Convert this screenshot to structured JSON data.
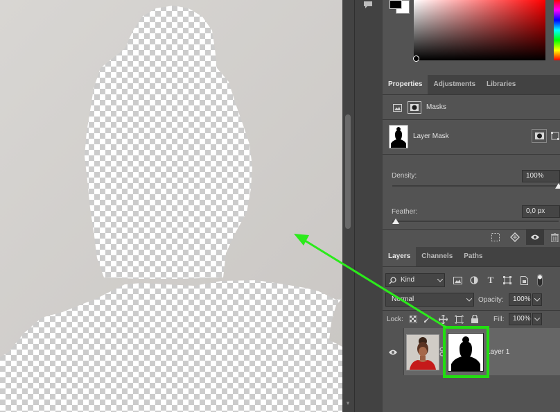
{
  "colors": {
    "mask_highlight": "#22dd11",
    "arrow": "#2bea1b",
    "canvas_bg": "#d3d0cd",
    "panel_bg": "#535353"
  },
  "properties": {
    "tabs": [
      {
        "label": "Properties"
      },
      {
        "label": "Adjustments"
      },
      {
        "label": "Libraries"
      }
    ],
    "section_label": "Masks",
    "mask_name": "Layer Mask",
    "density": {
      "label": "Density:",
      "value": "100%",
      "level": 1.0
    },
    "feather": {
      "label": "Feather:",
      "value": "0,0 px",
      "level": 0.0
    }
  },
  "layers_panel": {
    "tabs": [
      {
        "label": "Layers"
      },
      {
        "label": "Channels"
      },
      {
        "label": "Paths"
      }
    ],
    "filter_kind": "Kind",
    "blend_mode": "Normal",
    "opacity": {
      "label": "Opacity:",
      "value": "100%"
    },
    "lock_label": "Lock:",
    "fill": {
      "label": "Fill:",
      "value": "100%"
    },
    "layers": [
      {
        "name": "Layer 1",
        "visible": true,
        "has_mask": true
      }
    ]
  },
  "icons": [
    "eyedropper-icon",
    "image-icon",
    "mask-icon",
    "type-icon",
    "transform-icon",
    "smart-object-icon",
    "visibility-icon",
    "delete-icon"
  ]
}
